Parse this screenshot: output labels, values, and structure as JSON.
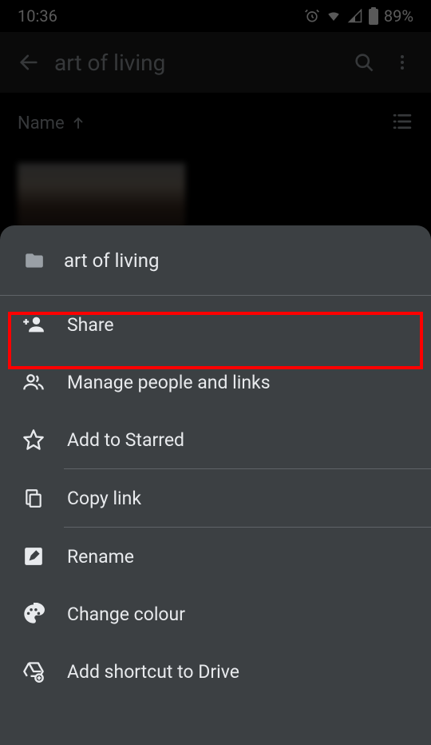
{
  "status": {
    "time": "10:36",
    "battery": "89%"
  },
  "app_bar": {
    "title": "art of living"
  },
  "sort": {
    "label": "Name"
  },
  "sheet": {
    "title": "art of living",
    "items": {
      "share": "Share",
      "manage": "Manage people and links",
      "starred": "Add to Starred",
      "copylink": "Copy link",
      "rename": "Rename",
      "colour": "Change colour",
      "shortcut": "Add shortcut to Drive"
    }
  }
}
